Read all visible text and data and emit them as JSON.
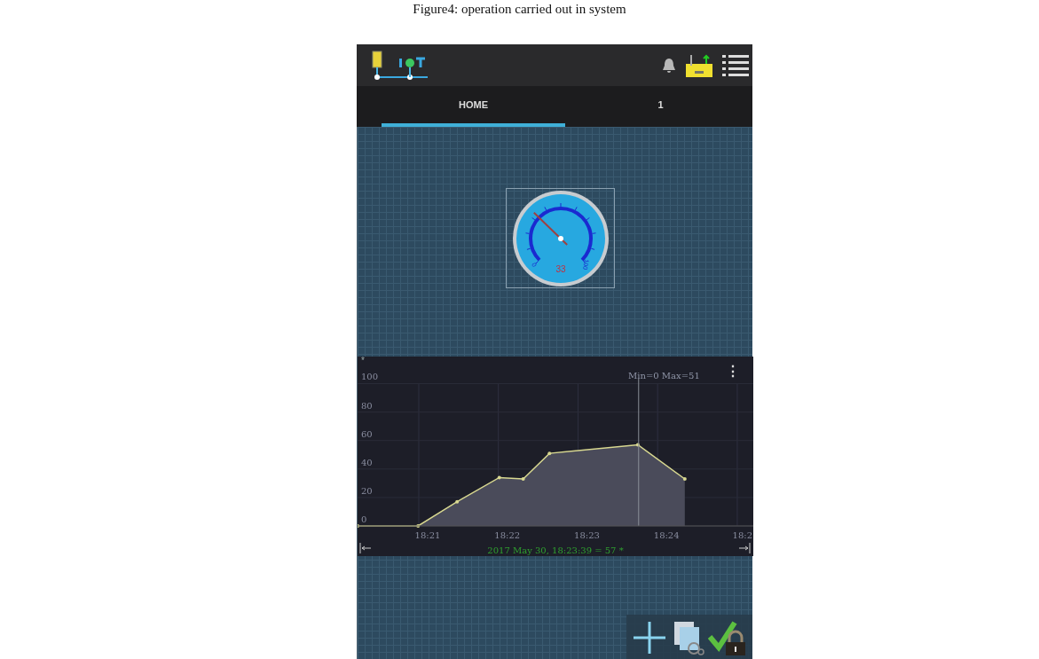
{
  "caption": "Figure4: operation carried out in system",
  "tabs": [
    {
      "label": "HOME",
      "selected": true
    },
    {
      "label": "1",
      "selected": false
    }
  ],
  "gauge": {
    "value": "33",
    "min_label": "0",
    "max_label": "100"
  },
  "chart": {
    "menu": "⋮",
    "min_max": "Min=0  Max=51",
    "cursor_readout": "2017 May 30, 18:23:39 = 57 *",
    "chart_data": {
      "type": "area",
      "ylabel": "*",
      "grid": true,
      "ref_lines": [
        {
          "axis": "x",
          "value": 1103.65
        }
      ],
      "x": [
        1100.12,
        1100.88,
        1101.37,
        1101.9,
        1102.2,
        1102.53,
        1103.64,
        1104.23
      ],
      "series": [
        {
          "color": "#d8d890",
          "values": [
            0,
            0,
            17,
            34,
            33,
            51,
            57,
            33
          ]
        }
      ],
      "xlim": [
        1100.12,
        1105.09
      ],
      "ylim": [
        0,
        119
      ],
      "xticks": [
        {
          "value": 1101,
          "label": "18:21"
        },
        {
          "value": 1102,
          "label": "18:22"
        },
        {
          "value": 1103,
          "label": "18:23"
        },
        {
          "value": 1104,
          "label": "18:24"
        },
        {
          "value": 1105,
          "label": "18:2"
        }
      ],
      "yticks": [
        0,
        20,
        40,
        60,
        80,
        100
      ]
    }
  }
}
